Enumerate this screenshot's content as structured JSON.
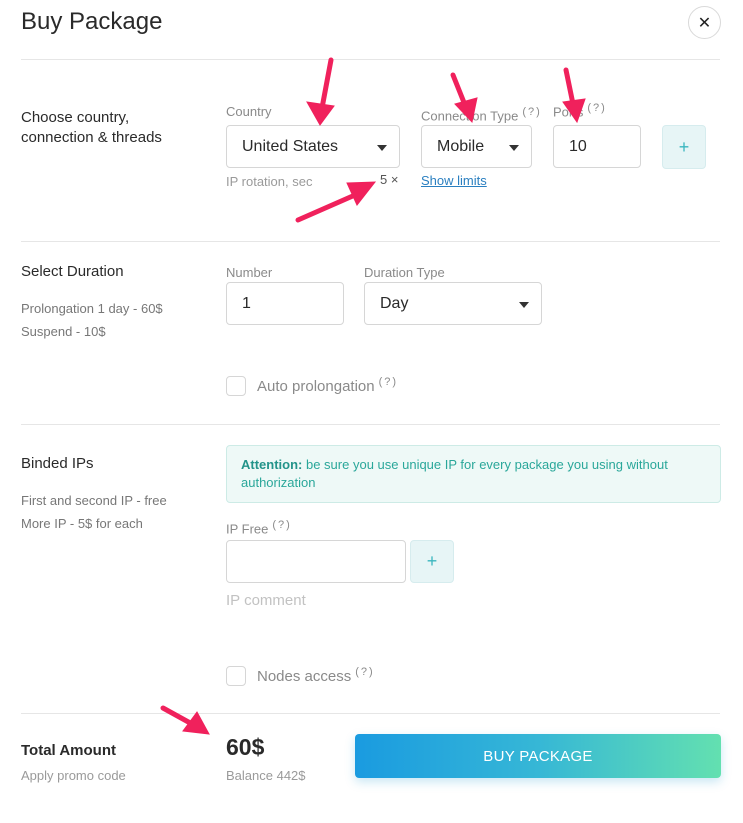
{
  "dialog": {
    "title": "Buy Package",
    "close_icon": "✕"
  },
  "section_country": {
    "title": "Choose country, connection & threads",
    "country_label": "Country",
    "country_value": "United States",
    "connection_label": "Connection Type",
    "connection_help": "(?)",
    "connection_value": "Mobile",
    "ports_label": "Ports",
    "ports_help": "(?)",
    "ports_value": "10",
    "plus": "+",
    "rotation_label": "IP rotation, sec",
    "rotation_value": "5 ×",
    "show_limits": "Show limits"
  },
  "section_duration": {
    "title": "Select Duration",
    "note_1": "Prolongation 1 day - 60$",
    "note_2": "Suspend - 10$",
    "number_label": "Number",
    "number_value": "1",
    "duration_type_label": "Duration Type",
    "duration_type_value": "Day",
    "auto_prolongation_label": "Auto prolongation",
    "auto_prolongation_help": "(?)"
  },
  "section_ips": {
    "title": "Binded IPs",
    "note_1": "First and second IP - free",
    "note_2": "More IP - 5$ for each",
    "alert_strong": "Attention:",
    "alert_text": " be sure you use unique IP for every package you using without authorization",
    "ip_label": "IP Free",
    "ip_help": "(?)",
    "ip_value": "",
    "plus": "+",
    "ip_comment_placeholder": "IP comment",
    "nodes_access_label": "Nodes access",
    "nodes_access_help": "(?)"
  },
  "footer": {
    "total_label": "Total Amount",
    "promo_link": "Apply promo code",
    "amount": "60$",
    "balance": "Balance 442$",
    "buy_button": "BUY PACKAGE"
  },
  "colors": {
    "accent": "#3bb6bf",
    "annotation": "#f0215c",
    "link": "#2a7fc0"
  }
}
